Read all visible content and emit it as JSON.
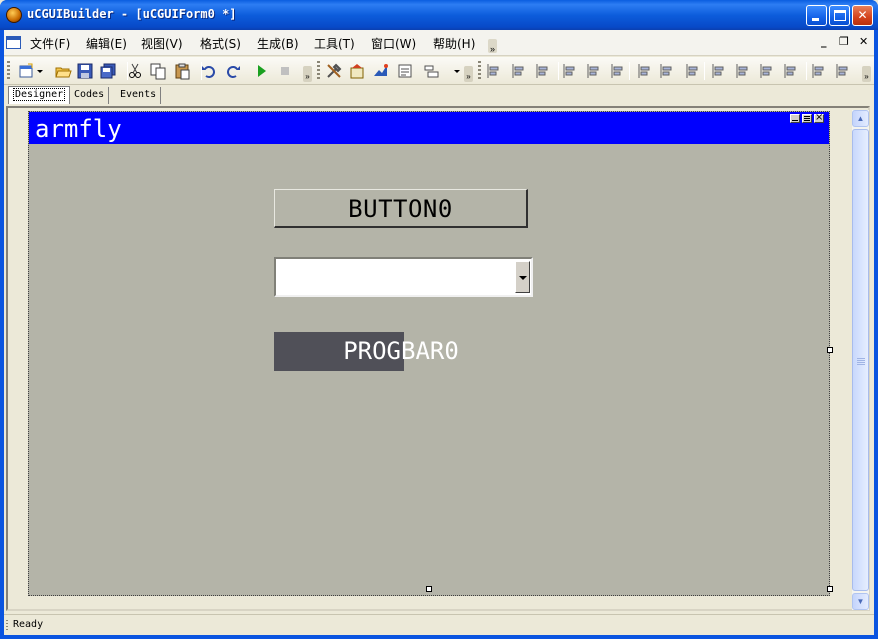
{
  "window": {
    "title": "uCGUIBuilder - [uCGUIForm0 *]",
    "accent": "#0a54e0"
  },
  "menu": {
    "items": [
      "文件(F)",
      "编辑(E)",
      "视图(V)",
      "格式(S)",
      "生成(B)",
      "工具(T)",
      "窗口(W)",
      "帮助(H)"
    ],
    "overflow": "»",
    "mdi_minimize": "_",
    "mdi_restore": "❐",
    "mdi_close": "✕"
  },
  "toolbar": {
    "buttons": [
      "new-form-icon",
      "open-folder-icon",
      "save-icon",
      "save-all-icon",
      "cut-icon",
      "copy-icon",
      "paste-icon",
      "undo-icon",
      "redo-icon",
      "run-icon",
      "stop-icon",
      "tools-icon",
      "properties-icon",
      "widget-icon",
      "form-icon",
      "window-list-icon",
      "align-left-icon",
      "align-center-icon",
      "align-right-icon",
      "align-top-icon",
      "align-middle-icon",
      "align-bottom-icon",
      "same-width-icon",
      "same-height-icon",
      "same-size-icon",
      "hspace-equal-icon",
      "hspace-increase-icon",
      "hspace-decrease-icon",
      "hspace-remove-icon",
      "vspace-equal-icon",
      "vspace-increase-icon"
    ],
    "overflow": "»"
  },
  "tabs": [
    {
      "label": "Designer",
      "active": true
    },
    {
      "label": "Codes",
      "active": false
    },
    {
      "label": "Events",
      "active": false
    }
  ],
  "form": {
    "title": "armfly",
    "title_color": "#0000ff",
    "background": "#b4b4a8",
    "button": {
      "label": "BUTTON0"
    },
    "dropdown": {
      "value": ""
    },
    "progbar": {
      "label": "PROGBAR0",
      "value": 0.51
    }
  },
  "status": {
    "text": "Ready"
  }
}
